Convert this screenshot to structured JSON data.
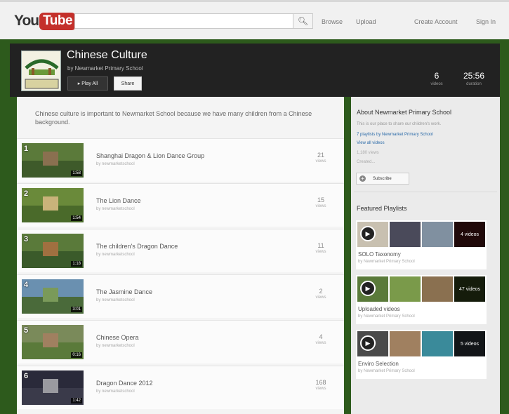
{
  "masthead": {
    "logo_you": "You",
    "logo_tube": "Tube",
    "search_placeholder": "",
    "browse": "Browse",
    "upload": "Upload",
    "create_account": "Create Account",
    "sign_in": "Sign In"
  },
  "channel": {
    "playlist_title": "Chinese Culture",
    "by_line": "by Newmarket Primary School",
    "play_all": "▸ Play All",
    "share": "Share",
    "stats": [
      {
        "value": "6",
        "label": "videos"
      },
      {
        "value": "25:56",
        "label": "duration"
      }
    ],
    "description": "Chinese culture is important to Newmarket School because we have many children from a Chinese background."
  },
  "videos": [
    {
      "index": "1",
      "title": "Shanghai Dragon & Lion Dance Group",
      "by": "by newmarketschool",
      "views": "21",
      "views_label": "views",
      "duration": "1:58",
      "colors": [
        "#5b7a3a",
        "#8a7050",
        "#3e5a2a"
      ]
    },
    {
      "index": "2",
      "title": "The Lion Dance",
      "by": "by newmarketschool",
      "views": "15",
      "views_label": "views",
      "duration": "1:54",
      "colors": [
        "#6a8a3a",
        "#c9b37a",
        "#4a6a2a"
      ]
    },
    {
      "index": "3",
      "title": "The children's Dragon Dance",
      "by": "by newmarketschool",
      "views": "11",
      "views_label": "views",
      "duration": "1:18",
      "colors": [
        "#5a7a3a",
        "#a07040",
        "#3a5a2a"
      ]
    },
    {
      "index": "4",
      "title": "The Jasmine Dance",
      "by": "by newmarketschool",
      "views": "2",
      "views_label": "views",
      "duration": "3:01",
      "colors": [
        "#6a90b0",
        "#7a9a5a",
        "#4a6a3a"
      ]
    },
    {
      "index": "5",
      "title": "Chinese Opera",
      "by": "by newmarketschool",
      "views": "4",
      "views_label": "views",
      "duration": "0:16",
      "colors": [
        "#7a8a5a",
        "#a08060",
        "#5a7a3a"
      ]
    },
    {
      "index": "6",
      "title": "Dragon Dance 2012",
      "by": "by newmarketschool",
      "views": "168",
      "views_label": "views",
      "duration": "1:42",
      "colors": [
        "#2a2a3a",
        "#9a9aa0",
        "#3a3a4a"
      ]
    }
  ],
  "sidebar": {
    "about_title": "About Newmarket Primary School",
    "about_text": "This is our place to share our children's work.",
    "subscribers": "7 playlists by Newmarket Primary School",
    "view_all": "View all videos",
    "videos_count": "1,180 views",
    "created": "Created...",
    "subscribe": "Subscribe",
    "featured_title": "Featured Playlists",
    "playlists": [
      {
        "title": "SOLO Taxonomy",
        "by": "by Newmarket Primary School",
        "count": "4 videos",
        "colors": [
          "#c8c0b0",
          "#4a4a5a",
          "#8090a0",
          "#a03030"
        ]
      },
      {
        "title": "Uploaded videos",
        "by": "by Newmarket Primary School",
        "count": "47 videos",
        "colors": [
          "#5a7a3a",
          "#7a9a4a",
          "#8a7050",
          "#6a8a3a"
        ]
      },
      {
        "title": "Enviro Selection",
        "by": "by Newmarket Primary School",
        "count": "5 videos",
        "colors": [
          "#4a4a4a",
          "#a08060",
          "#3a8a9a",
          "#5a6a7a"
        ]
      }
    ]
  },
  "colors": {
    "green_bg": "#2d5a1c",
    "header_bg": "#222222",
    "youtube_red": "#c4302b"
  }
}
